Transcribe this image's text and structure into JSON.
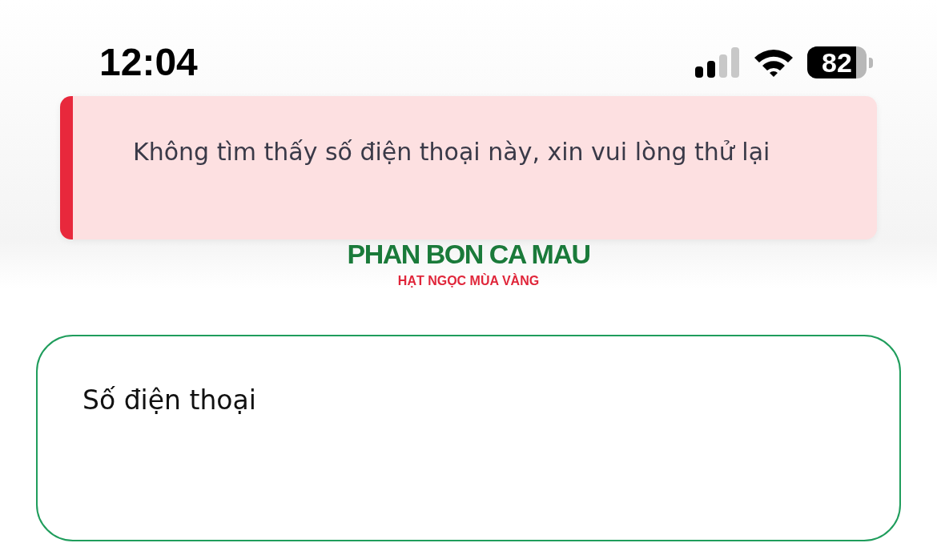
{
  "status_bar": {
    "time": "12:04",
    "battery": "82"
  },
  "toast": {
    "kind": "error",
    "message": "Không tìm thấy số điện thoại này, xin vui lòng thử lại"
  },
  "logo": {
    "name": "PHAN BON CA MAU",
    "tagline": "HẠT NGỌC MÙA VÀNG"
  },
  "phone_field": {
    "label": "Số điện thoại"
  }
}
